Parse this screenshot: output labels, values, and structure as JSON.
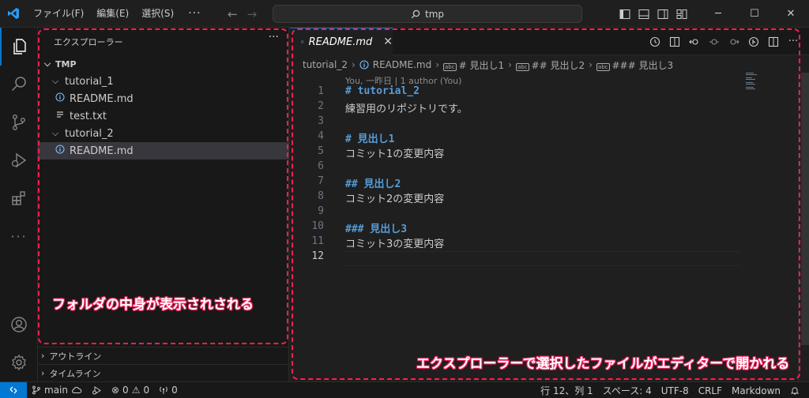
{
  "titlebar": {
    "menus": [
      "ファイル(F)",
      "編集(E)",
      "選択(S)"
    ],
    "more": "···",
    "search_text": "tmp"
  },
  "sidebar": {
    "title": "エクスプローラー",
    "more": "···",
    "root": "TMP",
    "folder1": "tutorial_1",
    "folder1_files": [
      "README.md",
      "test.txt"
    ],
    "folder2": "tutorial_2",
    "folder2_files": [
      "README.md"
    ],
    "outline": "アウトライン",
    "timeline": "タイムライン"
  },
  "editor": {
    "tab_label": "README.md",
    "breadcrumb": [
      "tutorial_2",
      "README.md",
      "# 見出し1",
      "## 見出し2",
      "### 見出し3"
    ],
    "blame": "You, 一昨日 | 1 author (You)",
    "lines": [
      {
        "num": "1",
        "text": "# tutorial_2",
        "kind": "heading"
      },
      {
        "num": "2",
        "text": "練習用のリポジトリです。",
        "kind": "text"
      },
      {
        "num": "3",
        "text": "",
        "kind": "text"
      },
      {
        "num": "4",
        "text": "# 見出し1",
        "kind": "heading"
      },
      {
        "num": "5",
        "text": "コミット1の変更内容",
        "kind": "text"
      },
      {
        "num": "6",
        "text": "",
        "kind": "text"
      },
      {
        "num": "7",
        "text": "## 見出し2",
        "kind": "heading"
      },
      {
        "num": "8",
        "text": "コミット2の変更内容",
        "kind": "text"
      },
      {
        "num": "9",
        "text": "",
        "kind": "text"
      },
      {
        "num": "10",
        "text": "### 見出し3",
        "kind": "heading"
      },
      {
        "num": "11",
        "text": "コミット3の変更内容",
        "kind": "text"
      },
      {
        "num": "12",
        "text": "",
        "kind": "text"
      }
    ]
  },
  "annotations": {
    "sidebar_note": "フォルダの中身が表示されされる",
    "editor_note": "エクスプローラーで選択したファイルがエディターで開かれる"
  },
  "statusbar": {
    "branch": "main",
    "errors": "0",
    "warnings": "0",
    "ports": "0",
    "position": "行 12、列 1",
    "spaces": "スペース: 4",
    "encoding": "UTF-8",
    "eol": "CRLF",
    "language": "Markdown"
  },
  "colors": {
    "accent": "#0078d4",
    "annotation": "#ff1f4b",
    "info_icon": "#75beff",
    "heading": "#569cd6"
  }
}
